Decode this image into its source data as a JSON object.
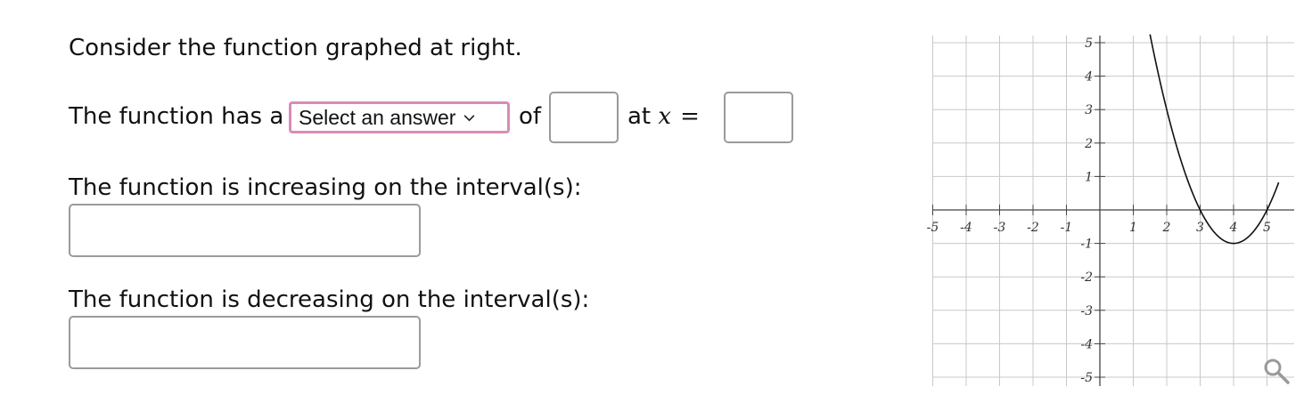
{
  "prompt": "Consider the function graphed at right.",
  "extremum_sentence": {
    "prefix": "The function has a",
    "select_value": "Select an answer",
    "of_label": "of",
    "at_label": "at",
    "variable": "x",
    "equals": "="
  },
  "increasing": {
    "label": "The function is increasing on the interval(s):",
    "value": ""
  },
  "decreasing": {
    "label": "The function is decreasing on the interval(s):",
    "value": ""
  },
  "graph": {
    "x_ticks": [
      "-5",
      "-4",
      "-3",
      "-2",
      "-1",
      "1",
      "2",
      "3",
      "4",
      "5"
    ],
    "y_ticks": [
      "5",
      "4",
      "3",
      "2",
      "1",
      "-1",
      "-2",
      "-3",
      "-4",
      "-5"
    ],
    "xlim": [
      -5,
      5
    ],
    "ylim": [
      -5,
      5
    ],
    "grid": "on",
    "curve": {
      "shape": "parabola opening upward",
      "vertex": [
        4,
        -1
      ],
      "points": [
        [
          2,
          3
        ],
        [
          3,
          0
        ],
        [
          4,
          -1
        ],
        [
          5,
          0
        ]
      ]
    },
    "zoom_icon": "magnifier-icon"
  },
  "colors": {
    "select_border": "#d98bb8",
    "input_border": "#9b9b9b",
    "grid": "#c8c8c8"
  }
}
